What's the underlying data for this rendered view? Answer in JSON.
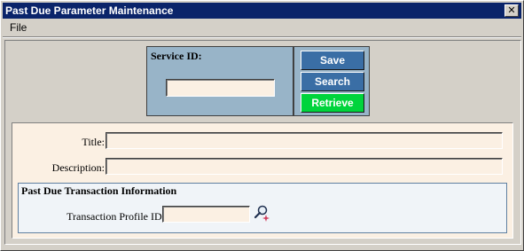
{
  "window": {
    "title": "Past Due Parameter Maintenance",
    "close_glyph": "✕"
  },
  "menu": {
    "items": [
      {
        "label": "File"
      }
    ]
  },
  "service": {
    "label": "Service ID:",
    "value": ""
  },
  "buttons": {
    "save": "Save",
    "search": "Search",
    "retrieve": "Retrieve"
  },
  "details": {
    "title_label": "Title:",
    "title_value": "",
    "description_label": "Description:",
    "description_value": ""
  },
  "transaction": {
    "heading": "Past Due Transaction Information",
    "profile_label": "Transaction Profile ID:",
    "profile_value": "",
    "lookup_icon": "magnifier-icon"
  },
  "colors": {
    "titlebar": "#0a246a",
    "panel_blue": "#98b4c8",
    "button_blue": "#3a6ea5",
    "button_green": "#00d43c",
    "field_bg": "#fbf0e3"
  }
}
